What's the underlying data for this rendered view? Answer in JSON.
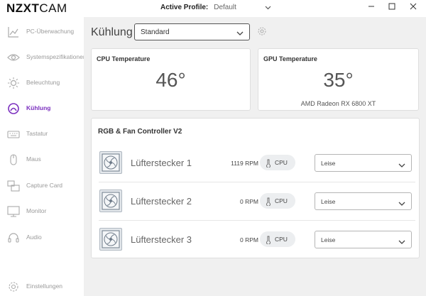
{
  "app": {
    "logo_bold": "NZXT",
    "logo_light": "CAM",
    "active_profile_label": "Active Profile:",
    "active_profile_value": "Default"
  },
  "sidebar": {
    "items": [
      {
        "label": "PC-Überwachung",
        "icon": "chart-line-icon",
        "active": false
      },
      {
        "label": "Systemspezifikationen",
        "icon": "eye-icon",
        "active": false
      },
      {
        "label": "Beleuchtung",
        "icon": "sun-icon",
        "active": false
      },
      {
        "label": "Kühlung",
        "icon": "cooling-icon",
        "active": true
      },
      {
        "label": "Tastatur",
        "icon": "keyboard-icon",
        "active": false
      },
      {
        "label": "Maus",
        "icon": "mouse-icon",
        "active": false
      },
      {
        "label": "Capture Card",
        "icon": "capture-card-icon",
        "active": false
      },
      {
        "label": "Monitor",
        "icon": "monitor-icon",
        "active": false
      },
      {
        "label": "Audio",
        "icon": "headset-icon",
        "active": false
      }
    ],
    "settings_label": "Einstellungen"
  },
  "main": {
    "title": "Kühlung",
    "profile_select": "Standard",
    "cpu": {
      "title": "CPU Temperature",
      "value": "46°"
    },
    "gpu": {
      "title": "GPU Temperature",
      "value": "35°",
      "model": "AMD Radeon RX 6800 XT"
    },
    "controller": {
      "title": "RGB & Fan Controller V2",
      "fans": [
        {
          "name": "Lüfterstecker 1",
          "rpm": "1119 RPM",
          "source": "CPU",
          "mode": "Leise"
        },
        {
          "name": "Lüfterstecker 2",
          "rpm": "0 RPM",
          "source": "CPU",
          "mode": "Leise"
        },
        {
          "name": "Lüfterstecker 3",
          "rpm": "0 RPM",
          "source": "CPU",
          "mode": "Leise"
        }
      ]
    }
  },
  "colors": {
    "accent": "#7b2fbf",
    "inactive": "#9a9a9a"
  }
}
